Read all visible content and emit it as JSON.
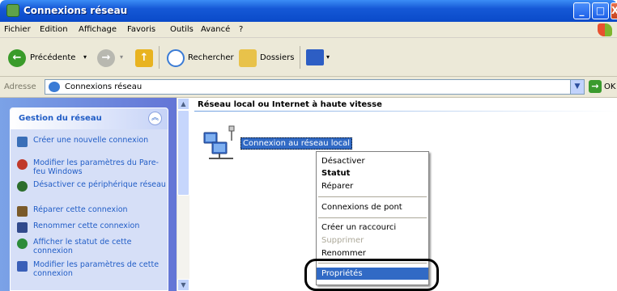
{
  "window": {
    "title": "Connexions réseau",
    "icon": "network-connections-icon",
    "controls": [
      "minimize-icon",
      "maximize-icon",
      "close-icon"
    ]
  },
  "menubar": [
    "Fichier",
    "Edition",
    "Affichage",
    "Favoris",
    "Outils",
    "Avancé",
    "?"
  ],
  "toolbar": {
    "back_label": "Précédente",
    "search_label": "Rechercher",
    "folders_label": "Dossiers"
  },
  "address": {
    "label": "Adresse",
    "value": "Connexions réseau",
    "go_label": "OK"
  },
  "sidepanel": {
    "title": "Gestion du réseau",
    "tasks": [
      {
        "label": "Créer une nouvelle connexion",
        "icon": "new-connection-icon",
        "color": "#3a6fb8"
      },
      {
        "label": "Modifier les paramètres du Pare-feu Windows",
        "icon": "firewall-icon",
        "color": "#c0392b"
      },
      {
        "label": "Désactiver ce périphérique réseau",
        "icon": "disable-device-icon",
        "color": "#2c6e2c"
      },
      {
        "label": "Réparer cette connexion",
        "icon": "repair-icon",
        "color": "#7a5a2a"
      },
      {
        "label": "Renommer cette connexion",
        "icon": "rename-icon",
        "color": "#314a8c"
      },
      {
        "label": "Afficher le statut de cette connexion",
        "icon": "status-icon",
        "color": "#2c8c3a"
      },
      {
        "label": "Modifier les paramètres de cette connexion",
        "icon": "properties-icon",
        "color": "#3a5fb8"
      }
    ]
  },
  "content": {
    "group_header": "Réseau local ou Internet à haute vitesse",
    "item_label": "Connexion au réseau local"
  },
  "context_menu": {
    "items": [
      {
        "label": "Désactiver",
        "bold": false,
        "disabled": false
      },
      {
        "label": "Statut",
        "bold": true,
        "disabled": false
      },
      {
        "label": "Réparer",
        "bold": false,
        "disabled": false
      },
      {
        "label": "Connexions de pont",
        "bold": false,
        "disabled": false
      },
      {
        "label": "Créer un raccourci",
        "bold": false,
        "disabled": false
      },
      {
        "label": "Supprimer",
        "bold": false,
        "disabled": true
      },
      {
        "label": "Renommer",
        "bold": false,
        "disabled": false
      },
      {
        "label": "Propriétés",
        "bold": false,
        "disabled": false,
        "selected": true
      }
    ]
  },
  "colors": {
    "title_blue": "#0a4ac9",
    "task_link": "#215dc6",
    "selection": "#316ac5"
  }
}
